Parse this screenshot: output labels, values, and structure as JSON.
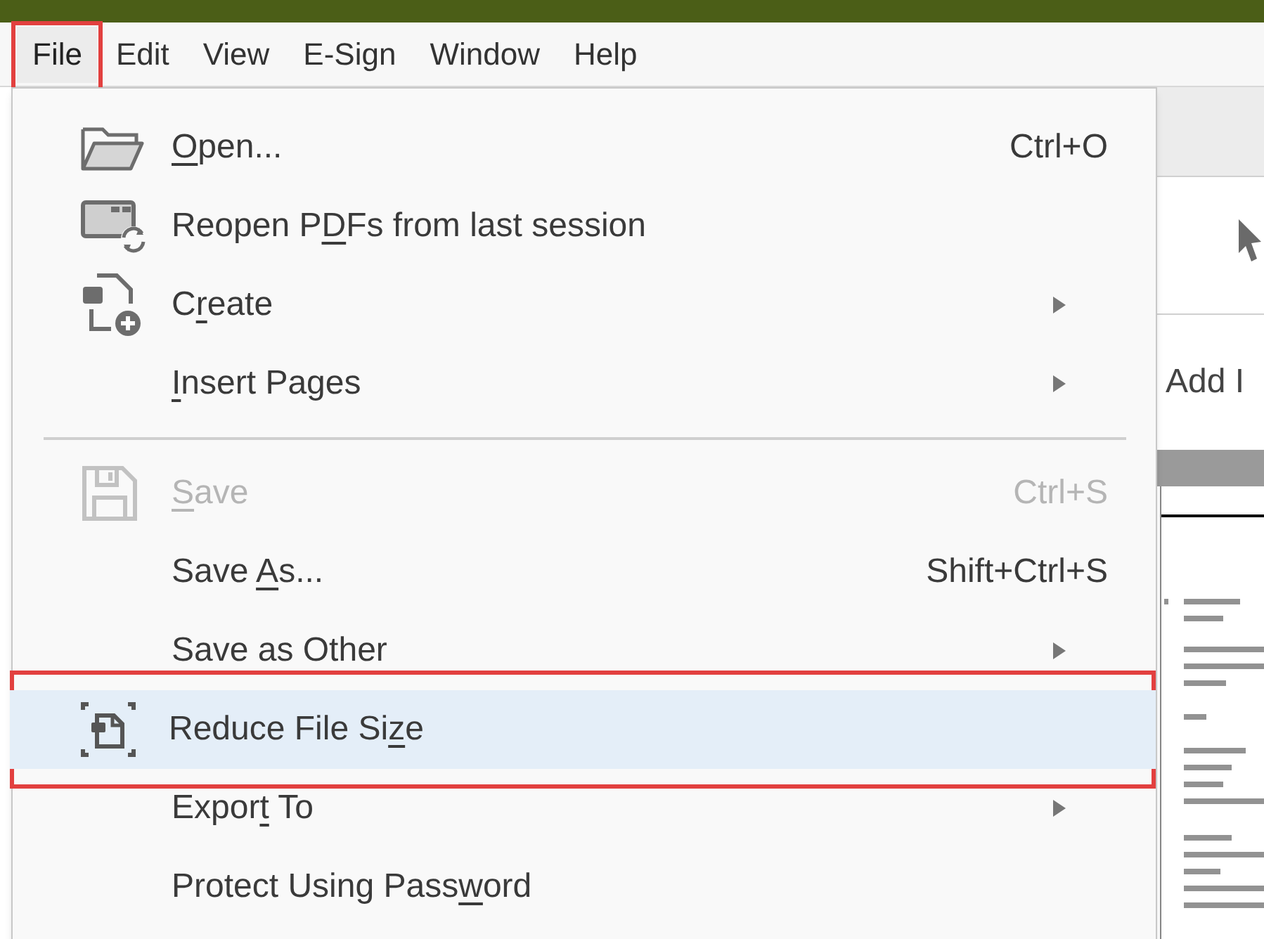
{
  "menu_bar": [
    {
      "label": "File",
      "selected": true,
      "annotated": true
    },
    {
      "label": "Edit",
      "selected": false,
      "annotated": false
    },
    {
      "label": "View",
      "selected": false,
      "annotated": false
    },
    {
      "label": "E-Sign",
      "selected": false,
      "annotated": false
    },
    {
      "label": "Window",
      "selected": false,
      "annotated": false
    },
    {
      "label": "Help",
      "selected": false,
      "annotated": false
    }
  ],
  "file_menu": [
    {
      "kind": "item",
      "access_key": "O",
      "label_end": "pen...",
      "shortcut": "Ctrl+O",
      "submenu": false,
      "disabled": false,
      "selected": false,
      "annotated": false
    },
    {
      "kind": "item",
      "label_start": "Reopen P",
      "access_key": "D",
      "label_end": "Fs from last session",
      "submenu": false,
      "disabled": false,
      "selected": false,
      "annotated": false
    },
    {
      "kind": "item",
      "label_start": "C",
      "access_key": "r",
      "label_end": "eate",
      "submenu": true,
      "disabled": false,
      "selected": false,
      "annotated": false
    },
    {
      "kind": "item",
      "access_key": "I",
      "label_end": "nsert Pages",
      "submenu": true,
      "disabled": false,
      "selected": false,
      "annotated": false
    },
    {
      "kind": "separator"
    },
    {
      "kind": "item",
      "access_key": "S",
      "label_end": "ave",
      "shortcut": "Ctrl+S",
      "submenu": false,
      "disabled": true,
      "selected": false,
      "annotated": false
    },
    {
      "kind": "item",
      "label_start": "Save ",
      "access_key": "A",
      "label_end": "s...",
      "shortcut": "Shift+Ctrl+S",
      "submenu": false,
      "disabled": false,
      "selected": false,
      "annotated": false
    },
    {
      "kind": "item",
      "label_start": "Save as Other",
      "submenu": true,
      "disabled": false,
      "selected": false,
      "annotated": false
    },
    {
      "kind": "item",
      "label_start": "Reduce File Si",
      "access_key": "z",
      "label_end": "e",
      "submenu": false,
      "disabled": false,
      "selected": true,
      "annotated": true
    },
    {
      "kind": "item",
      "label_start": "Expor",
      "access_key": "t",
      "label_end": " To",
      "submenu": true,
      "disabled": false,
      "selected": false,
      "annotated": false
    },
    {
      "kind": "item",
      "label_start": "Protect Using Pass",
      "access_key": "w",
      "label_end": "ord",
      "submenu": false,
      "disabled": false,
      "selected": false,
      "annotated": false
    }
  ],
  "side_panel": {
    "tool_label": "Add I"
  }
}
